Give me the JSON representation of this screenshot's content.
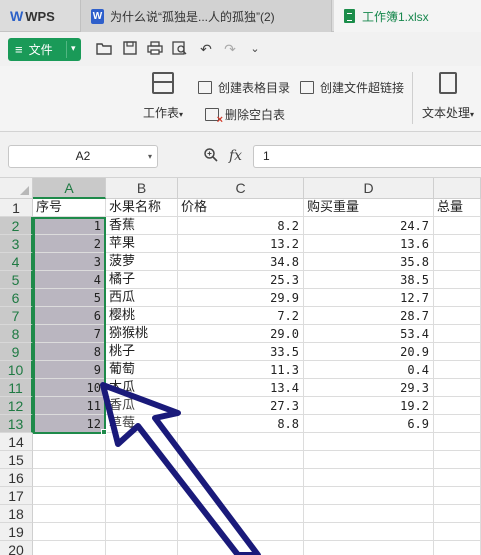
{
  "tabs": {
    "wps": "WPS",
    "doc": "为什么说“孤独是...人的孤独”(2)",
    "xlsx": "工作簿1.xlsx"
  },
  "menu": {
    "file_label": "文件"
  },
  "ribbon": {
    "sheet_label": "工作表",
    "create_toc": "创建表格目录",
    "create_link": "创建文件超链接",
    "delete_blank": "删除空白表",
    "text_process": "文本处理"
  },
  "formula_bar": {
    "name_box": "A2",
    "fx": "fx",
    "formula_value": "1"
  },
  "grid": {
    "columns": [
      "A",
      "B",
      "C",
      "D"
    ],
    "header_row": [
      "序号",
      "水果名称",
      "价格",
      "购买重量",
      "总量"
    ],
    "rows": [
      {
        "n": "1",
        "fruit": "香蕉",
        "price": "8.2",
        "weight": "24.7"
      },
      {
        "n": "2",
        "fruit": "苹果",
        "price": "13.2",
        "weight": "13.6"
      },
      {
        "n": "3",
        "fruit": "菠萝",
        "price": "34.8",
        "weight": "35.8"
      },
      {
        "n": "4",
        "fruit": "橘子",
        "price": "25.3",
        "weight": "38.5"
      },
      {
        "n": "5",
        "fruit": "西瓜",
        "price": "29.9",
        "weight": "12.7"
      },
      {
        "n": "6",
        "fruit": "樱桃",
        "price": "7.2",
        "weight": "28.7"
      },
      {
        "n": "7",
        "fruit": "猕猴桃",
        "price": "29.0",
        "weight": "53.4"
      },
      {
        "n": "8",
        "fruit": "桃子",
        "price": "33.5",
        "weight": "20.9"
      },
      {
        "n": "9",
        "fruit": "葡萄",
        "price": "11.3",
        "weight": "0.4"
      },
      {
        "n": "10",
        "fruit": "木瓜",
        "price": "13.4",
        "weight": "29.3"
      },
      {
        "n": "11",
        "fruit": "香瓜",
        "price": "27.3",
        "weight": "19.2"
      },
      {
        "n": "12",
        "fruit": "草莓",
        "price": "8.8",
        "weight": "6.9"
      }
    ],
    "row_numbers": [
      "1",
      "2",
      "3",
      "4",
      "5",
      "6",
      "7",
      "8",
      "9",
      "10",
      "11",
      "12",
      "13",
      "14",
      "15",
      "16",
      "17",
      "18",
      "19",
      "20"
    ]
  },
  "colors": {
    "accent_green": "#1e8a4a",
    "file_button": "#1a9a58",
    "arrow": "#1a1a7a"
  }
}
